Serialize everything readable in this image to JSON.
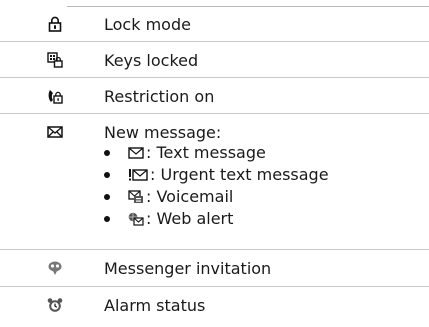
{
  "rows": [
    {
      "icon": "lock-icon",
      "label": "Lock mode"
    },
    {
      "icon": "keypad-lock-icon",
      "label": "Keys locked"
    },
    {
      "icon": "restricted-phone-icon",
      "label": "Restriction on"
    },
    {
      "icon": "envelope-icon",
      "label": "New message:",
      "subitems": [
        {
          "icon": "envelope-icon",
          "label": ": Text message"
        },
        {
          "icon": "urgent-envelope-icon",
          "label": ": Urgent text message"
        },
        {
          "icon": "voicemail-icon",
          "label": ": Voicemail"
        },
        {
          "icon": "web-alert-icon",
          "label": ": Web alert"
        }
      ]
    },
    {
      "icon": "messenger-invitation-icon",
      "label": "Messenger invitation"
    },
    {
      "icon": "alarm-clock-icon",
      "label": "Alarm status"
    }
  ]
}
